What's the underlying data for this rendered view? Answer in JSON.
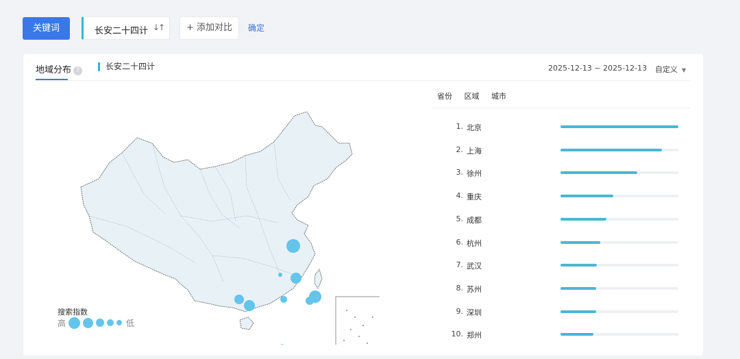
{
  "topbar": {
    "keyword_button": "关键词",
    "keyword": "长安二十四计",
    "sort_icon": "sort-icon",
    "add_compare": "+ 添加对比",
    "confirm": "确定"
  },
  "panel": {
    "tab_label": "地域分布",
    "help_icon": "?",
    "series_label": "长安二十四计",
    "date_range": "2025-12-13 ~ 2025-12-13",
    "date_mode": "自定义",
    "ranking_tabs": [
      "省份",
      "区域",
      "城市"
    ],
    "ranking": [
      {
        "rank": "1.",
        "city": "北京",
        "value": 1.0
      },
      {
        "rank": "2.",
        "city": "上海",
        "value": 0.86
      },
      {
        "rank": "3.",
        "city": "徐州",
        "value": 0.65
      },
      {
        "rank": "4.",
        "city": "重庆",
        "value": 0.45
      },
      {
        "rank": "5.",
        "city": "成都",
        "value": 0.39
      },
      {
        "rank": "6.",
        "city": "杭州",
        "value": 0.34
      },
      {
        "rank": "7.",
        "city": "武汉",
        "value": 0.31
      },
      {
        "rank": "8.",
        "city": "苏州",
        "value": 0.3
      },
      {
        "rank": "9.",
        "city": "深圳",
        "value": 0.3
      },
      {
        "rank": "10.",
        "city": "郑州",
        "value": 0.28
      }
    ],
    "legend": {
      "title": "搜索指数",
      "high": "高",
      "low": "低"
    }
  },
  "colors": {
    "primary": "#3a78e8",
    "accent": "#35b6d4",
    "bubble": "#63c4ec",
    "map_fill": "#e8f1f6"
  }
}
